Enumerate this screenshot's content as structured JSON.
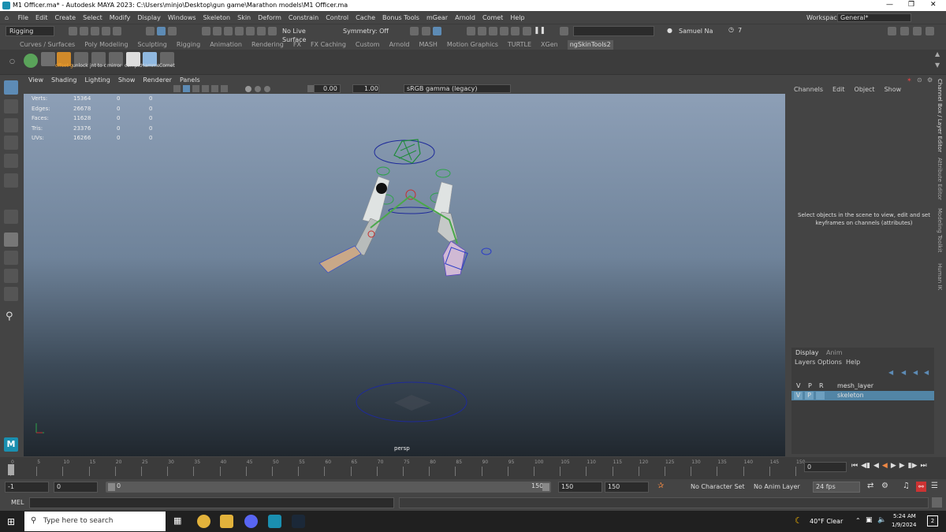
{
  "window": {
    "title": "M1 Officer.ma* - Autodesk MAYA 2023: C:\\Users\\minjo\\Desktop\\gun game\\Marathon models\\M1 Officer.ma"
  },
  "menus": [
    "File",
    "Edit",
    "Create",
    "Select",
    "Modify",
    "Display",
    "Windows",
    "Skeleton",
    "Skin",
    "Deform",
    "Constrain",
    "Control",
    "Cache",
    "Bonus Tools",
    "mGear",
    "Arnold",
    "Comet",
    "Help"
  ],
  "workspace": {
    "label": "Workspace:",
    "value": "General*"
  },
  "toolbar": {
    "menuset": "Rigging",
    "live_surface": "No Live Surface",
    "symmetry": "Symmetry: Off",
    "user": "Samuel Na",
    "notifications": "7"
  },
  "shelf_tabs": [
    "Curves / Surfaces",
    "Poly Modeling",
    "Sculpting",
    "Rigging",
    "Animation",
    "Rendering",
    "FX",
    "FX Caching",
    "Custom",
    "Arnold",
    "MASH",
    "Motion Graphics",
    "TURTLE",
    "XGen",
    "ngSkinTools2"
  ],
  "shelf_active": "ngSkinTools2",
  "shelf_buttons": [
    "offset g",
    "unlock",
    "jnt to c",
    "mirror",
    "complc",
    "Hamme",
    "Comet"
  ],
  "viewport_menu": [
    "View",
    "Shading",
    "Lighting",
    "Show",
    "Renderer",
    "Panels"
  ],
  "viewport_fields": {
    "exposure": "0.00",
    "gamma": "1.00",
    "color_space": "sRGB gamma (legacy)"
  },
  "hud": [
    {
      "label": "Verts:",
      "a": "15364",
      "b": "0",
      "c": "0"
    },
    {
      "label": "Edges:",
      "a": "26678",
      "b": "0",
      "c": "0"
    },
    {
      "label": "Faces:",
      "a": "11628",
      "b": "0",
      "c": "0"
    },
    {
      "label": "Tris:",
      "a": "23376",
      "b": "0",
      "c": "0"
    },
    {
      "label": "UVs:",
      "a": "16266",
      "b": "0",
      "c": "0"
    }
  ],
  "camera": "persp",
  "channel_box": {
    "menus": [
      "Channels",
      "Edit",
      "Object",
      "Show"
    ],
    "message": "Select objects in the scene to view, edit and set keyframes on channels (attributes)"
  },
  "side_tabs": [
    "Channel Box / Layer Editor",
    "Attribute Editor",
    "Modeling Toolkit",
    "Human IK"
  ],
  "layer_editor": {
    "tabs": [
      "Display",
      "Anim"
    ],
    "menus": [
      "Layers",
      "Options",
      "Help"
    ],
    "headers": [
      "V",
      "P",
      "R"
    ],
    "layers": [
      {
        "name": "mesh_layer",
        "v": "",
        "p": ""
      },
      {
        "name": "skeleton",
        "v": "V",
        "p": "P"
      }
    ]
  },
  "timeline": {
    "ticks": [
      "0",
      "5",
      "10",
      "15",
      "20",
      "25",
      "30",
      "35",
      "40",
      "45",
      "50",
      "55",
      "60",
      "65",
      "70",
      "75",
      "80",
      "85",
      "90",
      "95",
      "100",
      "105",
      "110",
      "115",
      "120",
      "125",
      "130",
      "135",
      "140",
      "145",
      "150"
    ],
    "current_frame": "0"
  },
  "range": {
    "start": "-1",
    "anim_start": "0",
    "range_start": "0",
    "range_end": "150",
    "end": "150",
    "anim_end": "150",
    "character_set": "No Character Set",
    "anim_layer": "No Anim Layer",
    "fps": "24 fps"
  },
  "command_line": {
    "label": "MEL"
  },
  "taskbar": {
    "search": "Type here to search",
    "weather": "40°F  Clear",
    "time": "5:24 AM",
    "date": "1/9/2024",
    "notif": "2"
  }
}
